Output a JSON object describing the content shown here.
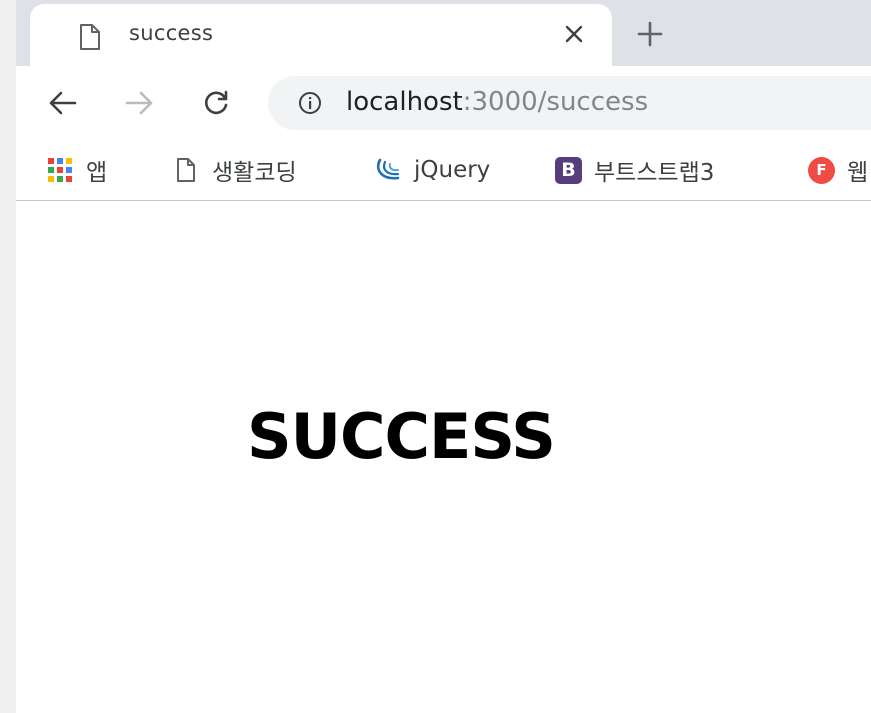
{
  "tab": {
    "title": "success",
    "close_glyph": "✕",
    "new_tab_glyph": "+"
  },
  "toolbar": {
    "url_host": "localhost",
    "url_path": ":3000/success"
  },
  "bookmarks": [
    {
      "label": "앱",
      "icon": "apps-grid-icon"
    },
    {
      "label": "생활코딩",
      "icon": "page-icon"
    },
    {
      "label": "jQuery",
      "icon": "jquery-icon"
    },
    {
      "label": "부트스트랩3",
      "icon": "bootstrap-icon",
      "icon_text": "B"
    },
    {
      "label": "웹",
      "icon": "f-icon",
      "icon_text": "F"
    }
  ],
  "page": {
    "heading": "SUCCESS"
  },
  "colors": {
    "tabstrip": "#dee1e6",
    "omnibox": "#f1f3f4",
    "bootstrap": "#563d7c",
    "f_icon": "#ee4c44"
  }
}
